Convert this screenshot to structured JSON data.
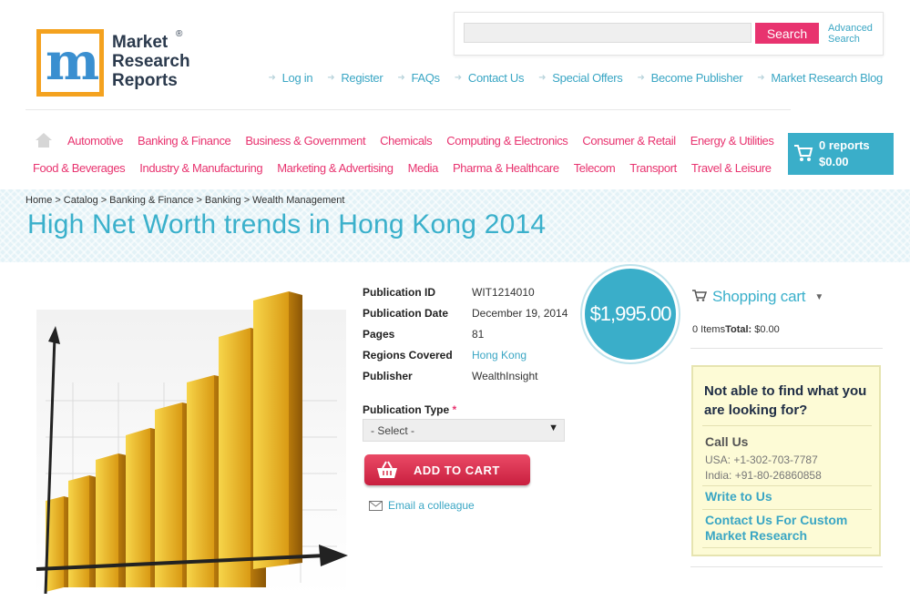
{
  "logo": {
    "line1": "Market",
    "line2": "Research",
    "line3": "Reports",
    "reg": "®",
    "letter": "m"
  },
  "search": {
    "placeholder": "",
    "button": "Search",
    "advanced": "Advanced Search"
  },
  "toplinks": [
    "Log in",
    "Register",
    "FAQs",
    "Contact Us",
    "Special Offers",
    "Become Publisher",
    "Market Research Blog"
  ],
  "nav": {
    "row1": [
      "Automotive",
      "Banking & Finance",
      "Business & Government",
      "Chemicals",
      "Computing & Electronics",
      "Consumer & Retail",
      "Energy & Utilities"
    ],
    "row2": [
      "Food & Beverages",
      "Industry & Manufacturing",
      "Marketing & Advertising",
      "Media",
      "Pharma & Healthcare",
      "Telecom",
      "Transport",
      "Travel & Leisure"
    ]
  },
  "cart": {
    "reports": "0 reports",
    "total": "$0.00"
  },
  "breadcrumb": [
    "Home",
    "Catalog",
    "Banking & Finance",
    "Banking",
    "Wealth Management"
  ],
  "breadcrumb_sep": ">",
  "title": "High Net Worth trends in Hong Kong 2014",
  "details": {
    "publication_id": {
      "label": "Publication ID",
      "value": "WIT1214010"
    },
    "publication_date": {
      "label": "Publication Date",
      "value": "December 19, 2014"
    },
    "pages": {
      "label": "Pages",
      "value": "81"
    },
    "regions": {
      "label": "Regions Covered",
      "value": "Hong Kong"
    },
    "publisher": {
      "label": "Publisher",
      "value": "WealthInsight"
    }
  },
  "price": "$1,995.00",
  "publication_type": {
    "label": "Publication Type",
    "required": "*",
    "selected": "- Select -"
  },
  "add_to_cart": "ADD TO CART",
  "email_colleague": "Email a colleague",
  "shopping_cart": {
    "title": "Shopping cart",
    "items": "0 Items",
    "total_label": "Total:",
    "total": "$0.00"
  },
  "help": {
    "title": "Not able to find what you are looking for?",
    "call_us": "Call Us",
    "usa": "USA: +1-302-703-7787",
    "india": "India: +91-80-26860858",
    "write_to_us": "Write to Us",
    "custom": "Contact Us For Custom Market Research"
  },
  "colors": {
    "pink": "#e8336f",
    "teal": "#3aaec9",
    "link": "#3aa6c4"
  }
}
